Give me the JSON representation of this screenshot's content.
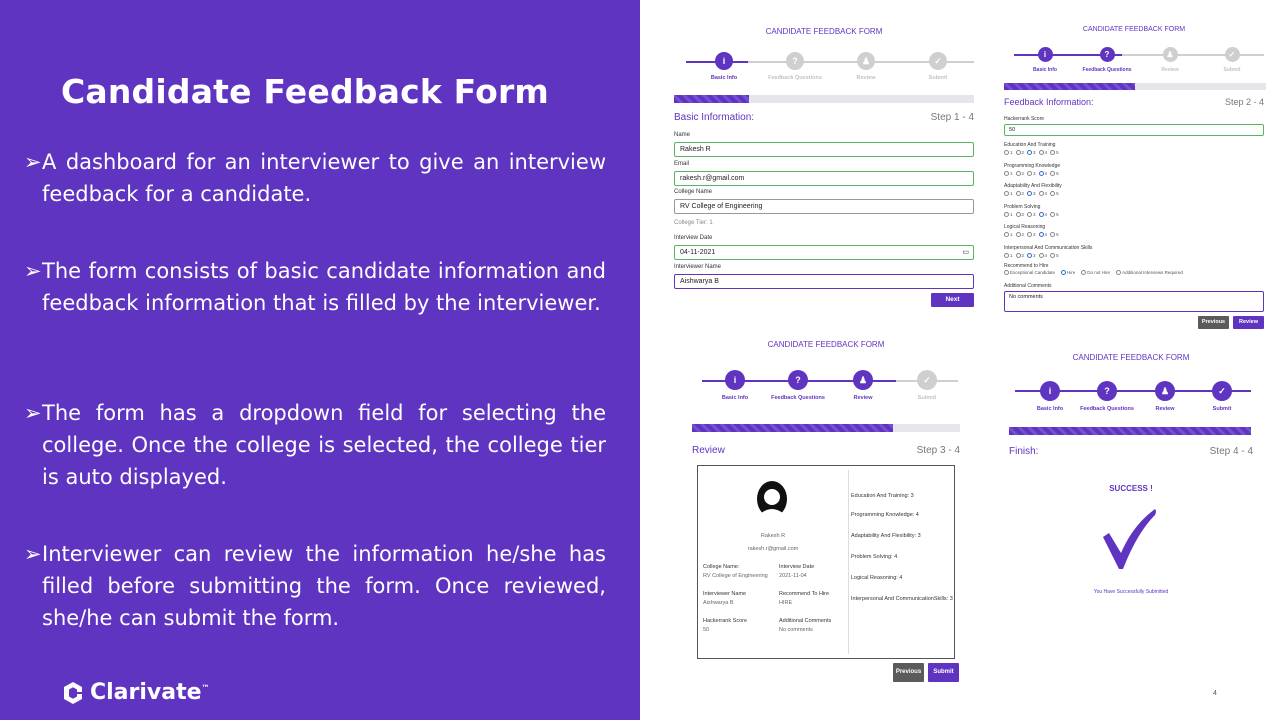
{
  "slide": {
    "title": "Candidate Feedback Form",
    "bullets": [
      "A dashboard for an interviewer to give an interview feedback for a candidate.",
      "The form consists of basic candidate information and  feedback information that is filled by the interviewer.",
      "The form has a dropdown field for selecting the college. Once the college is selected, the college tier is auto displayed.",
      "Interviewer can review the information he/she has filled before submitting the form. Once reviewed, she/he  can submit the form."
    ],
    "bullet_glyph": "➢",
    "logo_text": "Clarivate",
    "logo_tm": "™",
    "page_number": "4"
  },
  "form_title": "CANDIDATE FEEDBACK FORM",
  "steps": [
    "Basic Info",
    "Feedback Questions",
    "Review",
    "Submit"
  ],
  "step_icons": [
    "i",
    "?",
    "♟",
    "✓"
  ],
  "panel1": {
    "section": "Basic Information:",
    "step": "Step 1 - 4",
    "progress": 0.25,
    "fields": {
      "name_label": "Name",
      "name_value": "Rakesh R",
      "email_label": "Email",
      "email_value": "rakesh.r@gmail.com",
      "college_label": "College Name",
      "college_value": "RV College of Engineering",
      "tier_text": "College Tier: 1",
      "date_label": "Interview Date",
      "date_value": "04-11-2021",
      "interviewer_label": "Interviewer Name",
      "interviewer_value": "Aishwarya B"
    },
    "next": "Next"
  },
  "panel2": {
    "section": "Feedback Information:",
    "step": "Step 2 - 4",
    "progress": 0.5,
    "hacker_label": "Hackerrank Score",
    "hacker_value": "50",
    "questions": [
      {
        "label": "Education And Training",
        "selected": 3
      },
      {
        "label": "Programming Knowledge",
        "selected": 4
      },
      {
        "label": "Adaptability And Flexibility",
        "selected": 3
      },
      {
        "label": "Problem Solving",
        "selected": 4
      },
      {
        "label": "Logical Reasoning",
        "selected": 4
      },
      {
        "label": "Interpersonal And Communication Skills",
        "selected": 3
      }
    ],
    "rating_options": [
      "1",
      "2",
      "3",
      "4",
      "5"
    ],
    "recommend_label": "Recommend to Hire",
    "recommend_options": [
      "Exceptional Candidate",
      "Hire",
      "Do not Hire",
      "Additional Interviews Required"
    ],
    "recommend_selected": "Hire",
    "comments_label": "Additional Comments",
    "comments_value": "No comments",
    "previous": "Previous",
    "review": "Review"
  },
  "panel3": {
    "section": "Review",
    "step": "Step 3 - 4",
    "progress": 0.75,
    "name": "Rakesh R",
    "email": "rakesh.r@gmail.com",
    "college_label": "College Name:",
    "college_value": "RV College of Engineering",
    "date_label": "Interview Date",
    "date_value": "2021-11-04",
    "interviewer_label": "Interviewer Name",
    "interviewer_value": "Aishwarya B",
    "recommend_label": "Recommend To Hire",
    "recommend_value": "HIRE",
    "hacker_label": "Hackerrank Score",
    "hacker_value": "50",
    "comments_label": "Additional Comments",
    "comments_value": "No comments",
    "ratings": [
      "Education And Training: 3",
      "Programming Knowledge: 4",
      "Adaptability And Flexibility: 3",
      "Problem Solving: 4",
      "Logical Reasoning: 4",
      "Interpersonal And CommunicationSkills: 3"
    ],
    "previous": "Previous",
    "submit": "Submit"
  },
  "panel4": {
    "section": "Finish:",
    "step": "Step 4 - 4",
    "progress": 1.0,
    "success": "SUCCESS !",
    "message": "You Have Successfully Submitted"
  },
  "colors": {
    "accent": "#5f34c1",
    "success_border": "#57b661",
    "grey_button": "#5b5b5b"
  }
}
